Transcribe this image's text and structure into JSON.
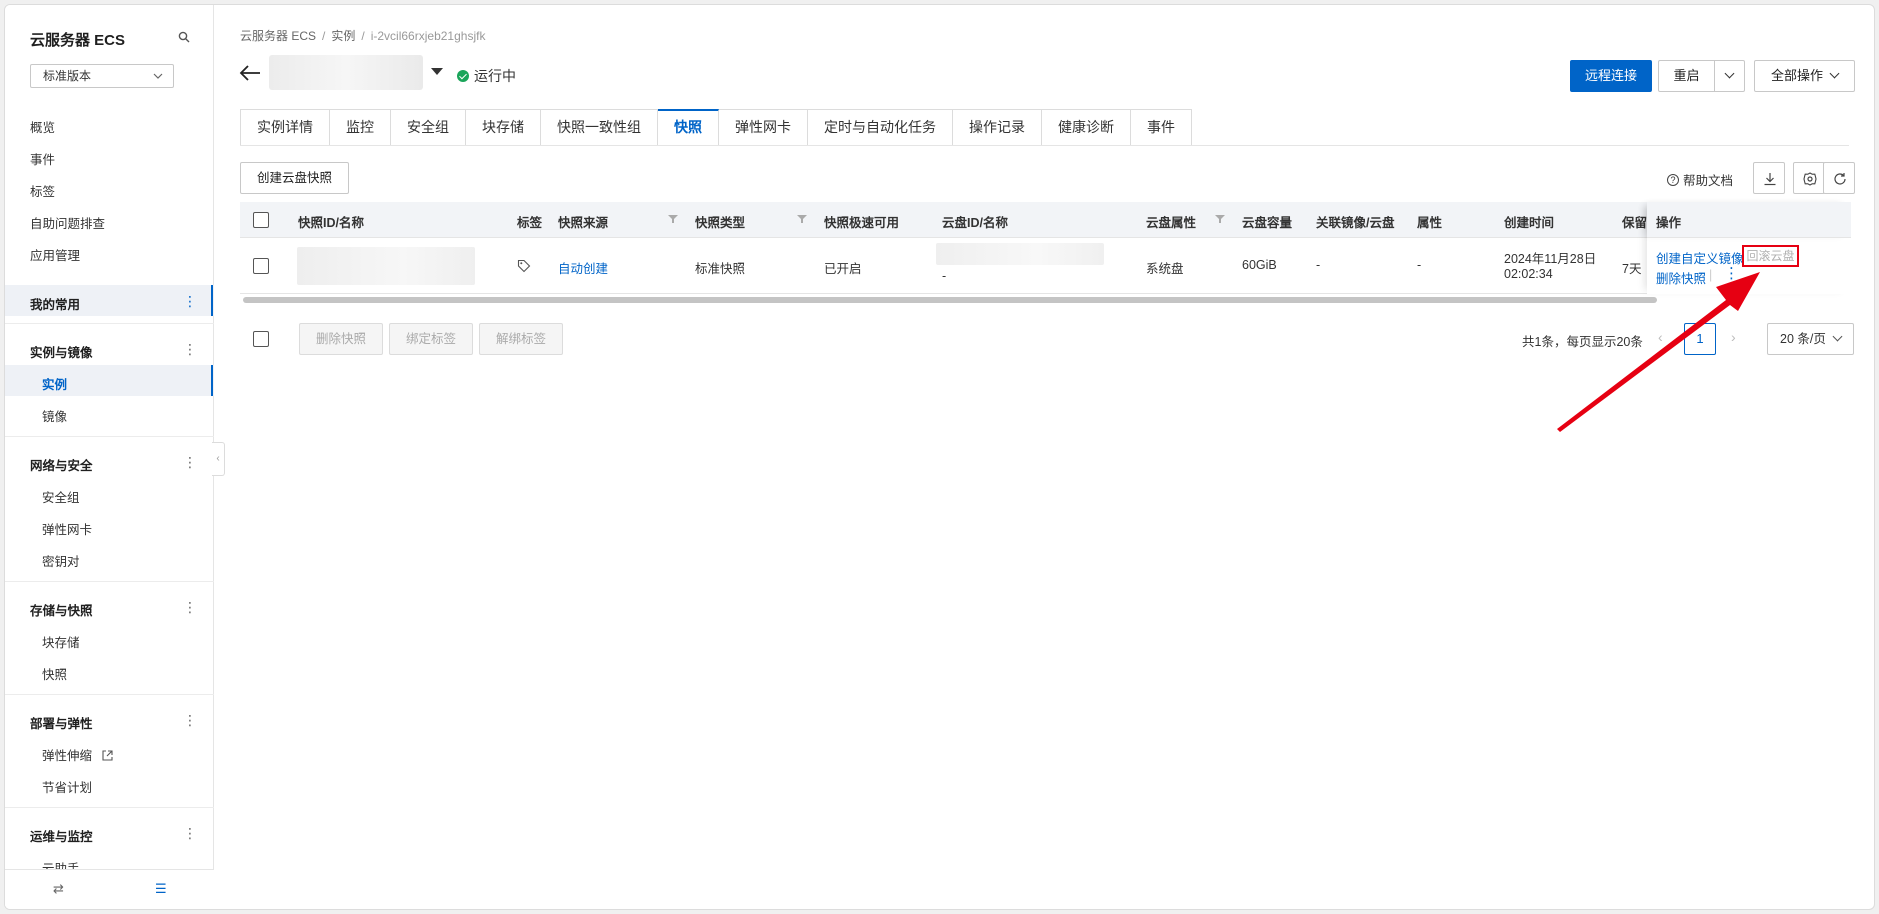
{
  "sidebar": {
    "title": "云服务器 ECS",
    "version": "标准版本",
    "top_items": [
      "概览",
      "事件",
      "标签",
      "自助问题排查",
      "应用管理"
    ],
    "favorites": "我的常用",
    "groups": [
      {
        "title": "实例与镜像",
        "items": [
          "实例",
          "镜像"
        ]
      },
      {
        "title": "网络与安全",
        "items": [
          "安全组",
          "弹性网卡",
          "密钥对"
        ]
      },
      {
        "title": "存储与快照",
        "items": [
          "块存储",
          "快照"
        ]
      },
      {
        "title": "部署与弹性",
        "items": [
          "弹性伸缩",
          "节省计划"
        ]
      },
      {
        "title": "运维与监控",
        "items": [
          "云助手"
        ]
      }
    ],
    "active_item": "实例"
  },
  "breadcrumb": [
    "云服务器 ECS",
    "实例",
    "i-2vcil66rxjeb21ghsjfk"
  ],
  "header": {
    "status": "运行中",
    "remote_button": "远程连接",
    "restart_button": "重启",
    "all_ops_button": "全部操作"
  },
  "tabs": [
    "实例详情",
    "监控",
    "安全组",
    "块存储",
    "快照一致性组",
    "快照",
    "弹性网卡",
    "定时与自动化任务",
    "操作记录",
    "健康诊断",
    "事件"
  ],
  "active_tab": "快照",
  "toolbar": {
    "create_button": "创建云盘快照",
    "help_label": "帮助文档"
  },
  "table": {
    "headers": {
      "id": "快照ID/名称",
      "tag": "标签",
      "source": "快照来源",
      "type": "快照类型",
      "fast": "快照极速可用",
      "disk": "云盘ID/名称",
      "attr": "云盘属性",
      "capacity": "云盘容量",
      "related": "关联镜像/云盘",
      "property": "属性",
      "created": "创建时间",
      "retain": "保留",
      "ops": "操作"
    },
    "rows": [
      {
        "source": "自动创建",
        "type": "标准快照",
        "fast": "已开启",
        "disk_name": "-",
        "attr": "系统盘",
        "capacity": "60GiB",
        "related": "-",
        "property": "-",
        "created_date": "2024年11月28日",
        "created_time": "02:02:34",
        "retain": "7天",
        "op_create_image": "创建自定义镜像",
        "op_rollback": "回滚云盘",
        "op_delete": "删除快照"
      }
    ]
  },
  "bulk": {
    "delete": "删除快照",
    "bind": "绑定标签",
    "unbind": "解绑标签"
  },
  "pager": {
    "summary": "共1条，每页显示20条",
    "current_page": "1",
    "page_size": "20 条/页"
  },
  "colors": {
    "primary": "#0064c8",
    "success": "#1aa55a",
    "highlight": "#e60012"
  }
}
